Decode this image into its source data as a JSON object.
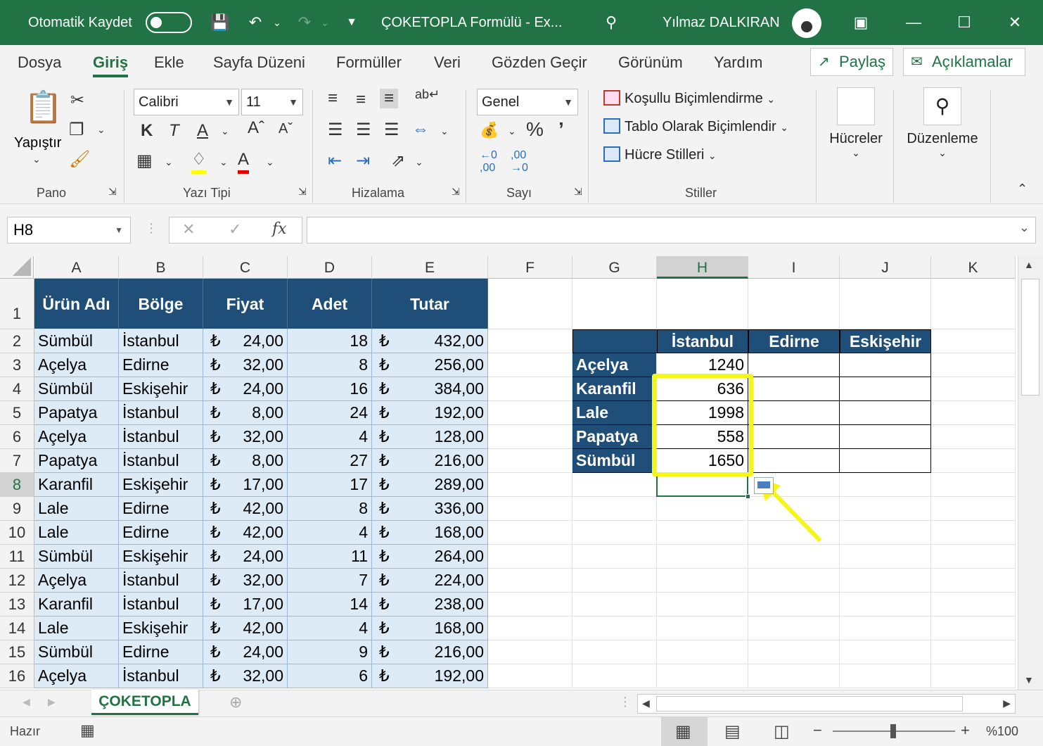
{
  "titlebar": {
    "autosave_label": "Otomatik Kaydet",
    "document_title": "ÇOKETOPLA Formülü  -  Ex...",
    "user_name": "Yılmaz DALKIRAN"
  },
  "ribbon_tabs": [
    "Dosya",
    "Giriş",
    "Ekle",
    "Sayfa Düzeni",
    "Formüller",
    "Veri",
    "Gözden Geçir",
    "Görünüm",
    "Yardım"
  ],
  "share_button": "Paylaş",
  "comments_button": "Açıklamalar",
  "ribbon": {
    "paste_label": "Yapıştır",
    "group_clipboard": "Pano",
    "font_name": "Calibri",
    "font_size": "11",
    "group_font": "Yazı Tipi",
    "group_alignment": "Hizalama",
    "number_format": "Genel",
    "group_number": "Sayı",
    "conditional_formatting": "Koşullu Biçimlendirme",
    "format_as_table": "Tablo Olarak Biçimlendir",
    "cell_styles": "Hücre Stilleri",
    "group_styles": "Stiller",
    "cells_label": "Hücreler",
    "editing_label": "Düzenleme",
    "bold_label": "K",
    "italic_label": "T",
    "underline_label": "A"
  },
  "formula_bar": {
    "name_box": "H8",
    "fx_label": "fx",
    "formula": ""
  },
  "columns": [
    "A",
    "B",
    "C",
    "D",
    "E",
    "F",
    "G",
    "H",
    "I",
    "J",
    "K"
  ],
  "selected_column": "H",
  "rows": [
    "1",
    "2",
    "3",
    "4",
    "5",
    "6",
    "7",
    "8",
    "9",
    "10",
    "11",
    "12",
    "13",
    "14",
    "15",
    "16"
  ],
  "selected_row": "8",
  "table_headers": [
    "Ürün Adı",
    "Bölge",
    "Fiyat",
    "Adet",
    "Tutar"
  ],
  "currency_symbol": "₺",
  "table_rows": [
    [
      "Sümbül",
      "İstanbul",
      "24,00",
      "18",
      "432,00"
    ],
    [
      "Açelya",
      "Edirne",
      "32,00",
      "8",
      "256,00"
    ],
    [
      "Sümbül",
      "Eskişehir",
      "24,00",
      "16",
      "384,00"
    ],
    [
      "Papatya",
      "İstanbul",
      "8,00",
      "24",
      "192,00"
    ],
    [
      "Açelya",
      "İstanbul",
      "32,00",
      "4",
      "128,00"
    ],
    [
      "Papatya",
      "İstanbul",
      "8,00",
      "27",
      "216,00"
    ],
    [
      "Karanfil",
      "Eskişehir",
      "17,00",
      "17",
      "289,00"
    ],
    [
      "Lale",
      "Edirne",
      "42,00",
      "8",
      "336,00"
    ],
    [
      "Lale",
      "Edirne",
      "42,00",
      "4",
      "168,00"
    ],
    [
      "Sümbül",
      "Eskişehir",
      "24,00",
      "11",
      "264,00"
    ],
    [
      "Açelya",
      "İstanbul",
      "32,00",
      "7",
      "224,00"
    ],
    [
      "Karanfil",
      "İstanbul",
      "17,00",
      "14",
      "238,00"
    ],
    [
      "Lale",
      "Eskişehir",
      "42,00",
      "4",
      "168,00"
    ],
    [
      "Sümbül",
      "Edirne",
      "24,00",
      "9",
      "216,00"
    ],
    [
      "Açelya",
      "İstanbul",
      "32,00",
      "6",
      "192,00"
    ]
  ],
  "summary": {
    "col_headers": [
      "İstanbul",
      "Edirne",
      "Eskişehir"
    ],
    "row_labels": [
      "Açelya",
      "Karanfil",
      "Lale",
      "Papatya",
      "Sümbül"
    ],
    "istanbul_values": [
      "1240",
      "636",
      "1998",
      "558",
      "1650"
    ]
  },
  "sheet_tab": "ÇOKETOPLA",
  "status": {
    "ready": "Hazır",
    "zoom": "%100"
  },
  "colors": {
    "excel_green": "#217346",
    "header_blue": "#1f4e78",
    "data_fill": "#ddebf7",
    "highlight_yellow": "#f5f51a"
  }
}
